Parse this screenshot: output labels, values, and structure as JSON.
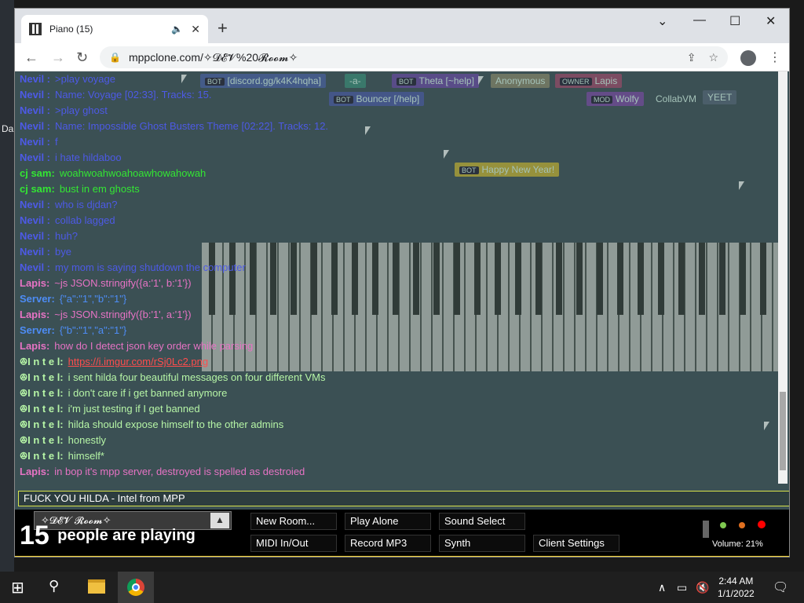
{
  "browser": {
    "tab_title": "Piano (15)",
    "url": "mppclone.com/✧𝓓𝓔𝓥%20𝓡𝓸𝓸𝓶✧"
  },
  "desktop_label": "Da",
  "overlays": [
    {
      "text": "[discord.gg/k4K4hqha]",
      "badge": "BOT",
      "color": "#4a62a5"
    },
    {
      "text": "-a-",
      "badge": "",
      "color": "#3a8e78"
    },
    {
      "text": "Theta [~help]",
      "badge": "BOT",
      "color": "#6a4aa5"
    },
    {
      "text": "Anonymous",
      "badge": "",
      "color": "#8a8a6a"
    },
    {
      "text": "Lapis",
      "badge": "OWNER",
      "color": "#a04a6a"
    },
    {
      "text": "Bouncer [/help]",
      "badge": "BOT",
      "color": "#4a5aa5"
    },
    {
      "text": "Wolfy",
      "badge": "MOD",
      "color": "#7a4aa5"
    },
    {
      "text": "CollabVM",
      "badge": "",
      "color": "transparent"
    },
    {
      "text": "YEET",
      "badge": "",
      "color": "#567"
    },
    {
      "text": "Happy New Year!",
      "badge": "BOT",
      "color": "#c8b430"
    }
  ],
  "messages": [
    {
      "name": "Nevil :",
      "text": ">play voyage",
      "color": "#4d5ae6"
    },
    {
      "name": "Nevil :",
      "text": "Name: Voyage [02:33]. Tracks: 15.",
      "color": "#4d5ae6"
    },
    {
      "name": "Nevil :",
      "text": ">play ghost",
      "color": "#4d5ae6"
    },
    {
      "name": "Nevil :",
      "text": "Name: Impossible Ghost Busters Theme [02:22]. Tracks: 12.",
      "color": "#4d5ae6"
    },
    {
      "name": "Nevil :",
      "text": "f",
      "color": "#4d5ae6"
    },
    {
      "name": "Nevil :",
      "text": "i hate hildaboo",
      "color": "#4d5ae6"
    },
    {
      "name": "cj sam:",
      "text": "woahwoahwoahoawhowahowah",
      "color": "#33e633"
    },
    {
      "name": "cj sam:",
      "text": "bust in em ghosts",
      "color": "#33e633"
    },
    {
      "name": "Nevil :",
      "text": "who is djdan?",
      "color": "#4d5ae6"
    },
    {
      "name": "Nevil :",
      "text": "collab lagged",
      "color": "#4d5ae6"
    },
    {
      "name": "Nevil :",
      "text": "huh?",
      "color": "#4d5ae6"
    },
    {
      "name": "Nevil :",
      "text": "bye",
      "color": "#4d5ae6"
    },
    {
      "name": "Nevil :",
      "text": "my mom is saying shutdown the computer",
      "color": "#4d5ae6"
    },
    {
      "name": "Lapis:",
      "text": "~js JSON.stringify({a:'1', b:'1'})",
      "color": "#e673c4"
    },
    {
      "name": "Server:",
      "text": "{\"a\":\"1\",\"b\":\"1\"}",
      "color": "#4d8cf5"
    },
    {
      "name": "Lapis:",
      "text": "~js JSON.stringify({b:'1', a:'1'})",
      "color": "#e673c4"
    },
    {
      "name": "Server:",
      "text": "{\"b\":\"1\",\"a\":\"1\"}",
      "color": "#4d8cf5"
    },
    {
      "name": "Lapis:",
      "text": "how do I detect json key order while parsing",
      "color": "#e673c4"
    },
    {
      "name": "ꔮI n t e l:",
      "text": "https://i.imgur.com/rSj0Lc2.png",
      "color": "#b6f5a6",
      "link": true
    },
    {
      "name": "ꔮI n t e l:",
      "text": "i sent hilda four beautiful messages on four different VMs",
      "color": "#b6f5a6"
    },
    {
      "name": "ꔮI n t e l:",
      "text": "i don't care if i get banned anymore",
      "color": "#b6f5a6"
    },
    {
      "name": "ꔮI n t e l:",
      "text": "i'm just testing if I get banned",
      "color": "#b6f5a6"
    },
    {
      "name": "ꔮI n t e l:",
      "text": "hilda should expose himself to the other admins",
      "color": "#b6f5a6"
    },
    {
      "name": "ꔮI n t e l:",
      "text": "honestly",
      "color": "#b6f5a6"
    },
    {
      "name": "ꔮI n t e l:",
      "text": "himself*",
      "color": "#b6f5a6"
    },
    {
      "name": "Lapis:",
      "text": "in bop it's mpp server, destroyed is spelled as destroied",
      "color": "#e673c4"
    }
  ],
  "chat_input_value": "FUCK YOU HILDA - Intel from MPP",
  "room": {
    "name": "✧𝓓𝓔𝓥 𝓡𝓸𝓸𝓶✧"
  },
  "player_count": {
    "number": "15",
    "text": "people are playing"
  },
  "buttons": {
    "new_room": "New Room...",
    "play_alone": "Play Alone",
    "sound_select": "Sound Select",
    "midi": "MIDI In/Out",
    "record": "Record MP3",
    "synth": "Synth",
    "client_settings": "Client Settings"
  },
  "volume_label": "Volume: 21%",
  "taskbar": {
    "time": "2:44 AM",
    "date": "1/1/2022"
  },
  "status_colors": {
    "green": "#7ec850",
    "orange": "#e07020",
    "red": "#ff0000"
  }
}
